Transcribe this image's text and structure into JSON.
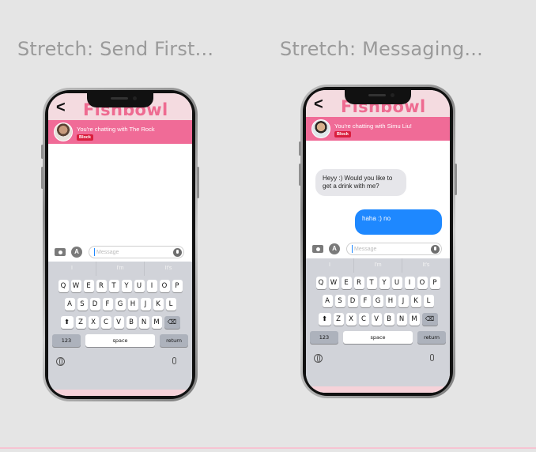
{
  "frames": [
    {
      "title": "Stretch: Send First...",
      "brand": "Fishbowl",
      "chat_with": "You're chatting with The Rock",
      "block_label": "Block",
      "messages": []
    },
    {
      "title": "Stretch: Messaging...",
      "brand": "Fishbowl",
      "chat_with": "You're chatting with Simu Liu!",
      "block_label": "Block",
      "messages": [
        {
          "direction": "in",
          "text": "Heyy :) Would you like to get a drink with me?"
        },
        {
          "direction": "out",
          "text": "haha :) no"
        }
      ]
    }
  ],
  "back_glyph": "<",
  "apps_glyph": "A",
  "compose": {
    "placeholder": "Message"
  },
  "keyboard": {
    "suggestions": [
      "I",
      "I'm",
      "It's"
    ],
    "row1": [
      "Q",
      "W",
      "E",
      "R",
      "T",
      "Y",
      "U",
      "I",
      "O",
      "P"
    ],
    "row2": [
      "A",
      "S",
      "D",
      "F",
      "G",
      "H",
      "J",
      "K",
      "L"
    ],
    "row3": [
      "Z",
      "X",
      "C",
      "V",
      "B",
      "N",
      "M"
    ],
    "shift": "⬆",
    "backspace": "⌫",
    "numbers": "123",
    "space": "space",
    "return": "return"
  }
}
